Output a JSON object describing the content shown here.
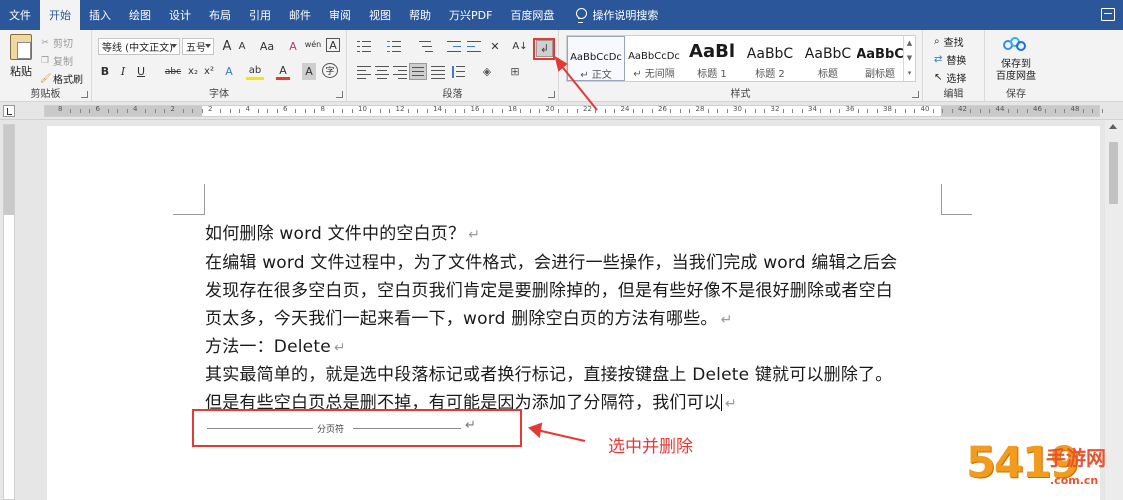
{
  "menubar": {
    "tabs": [
      "文件",
      "开始",
      "插入",
      "绘图",
      "设计",
      "布局",
      "引用",
      "邮件",
      "审阅",
      "视图",
      "帮助",
      "万兴PDF",
      "百度网盘"
    ],
    "active_tab": "开始",
    "search_label": "操作说明搜索"
  },
  "ribbon": {
    "clipboard": {
      "label": "剪贴板",
      "paste": "粘贴",
      "cut": "剪切",
      "copy": "复制",
      "format_painter": "格式刷"
    },
    "font": {
      "label": "字体",
      "font_name": "等线 (中文正文)",
      "font_size": "五号",
      "grow": "A",
      "shrink": "A",
      "case": "Aa",
      "clear": "A",
      "wen": "wén",
      "char_border": "A",
      "bold": "B",
      "italic": "I",
      "underline": "U",
      "strikethrough": "abc",
      "subscript": "x₂",
      "superscript": "x²",
      "text_effect": "A",
      "highlight": "ab",
      "font_color": "A",
      "char_shade": "A",
      "enclosed": "字"
    },
    "paragraph": {
      "label": "段落"
    },
    "styles": {
      "label": "样式",
      "items": [
        {
          "sample": "AaBbCcDc",
          "name": "正文"
        },
        {
          "sample": "AaBbCcDc",
          "name": "无间隔"
        },
        {
          "sample": "AaBl",
          "name": "标题 1"
        },
        {
          "sample": "AaBbC",
          "name": "标题 2"
        },
        {
          "sample": "AaBbC",
          "name": "标题"
        },
        {
          "sample": "AaBbC",
          "name": "副标题"
        }
      ]
    },
    "editing": {
      "label": "编辑",
      "find": "查找",
      "replace": "替换",
      "select": "选择"
    },
    "save": {
      "label": "保存",
      "button_line1": "保存到",
      "button_line2": "百度网盘"
    }
  },
  "ruler": {
    "numbers": [
      "8",
      "6",
      "4",
      "2",
      "2",
      "4",
      "6",
      "8",
      "10",
      "12",
      "14",
      "16",
      "18",
      "20",
      "22",
      "24",
      "26",
      "28",
      "30",
      "32",
      "34",
      "36",
      "38",
      "40",
      "42",
      "44",
      "46",
      "48"
    ]
  },
  "document": {
    "lines": [
      {
        "text": "如何删除 word 文件中的空白页？",
        "mark": "↵"
      },
      {
        "text": "在编辑 word 文件过程中，为了文件格式，会进行一些操作，当我们完成 word 编辑之后会",
        "mark": ""
      },
      {
        "text": "发现存在很多空白页，空白页我们肯定是要删除掉的，但是有些好像不是很好删除或者空白",
        "mark": ""
      },
      {
        "text": "页太多，今天我们一起来看一下，word 删除空白页的方法有哪些。",
        "mark": "↵"
      },
      {
        "text": "方法一：Delete",
        "mark": "↵"
      },
      {
        "text": "其实最简单的，就是选中段落标记或者换行标记，直接按键盘上 Delete 键就可以删除了。",
        "mark": ""
      },
      {
        "text": "但是有些空白页总是删不掉，有可能是因为添加了分隔符，我们可以",
        "mark": "↵"
      }
    ],
    "page_break_label": "分页符",
    "page_break_mark": "↵"
  },
  "annotation": {
    "text": "选中并删除",
    "color": "#e53935"
  },
  "watermark": {
    "big": "5419",
    "cn": "手游网",
    "url": ".com.cn"
  },
  "colors": {
    "accent": "#2b579a",
    "annotation_red": "#e53935",
    "watermark_orange": "#f29c1f"
  }
}
